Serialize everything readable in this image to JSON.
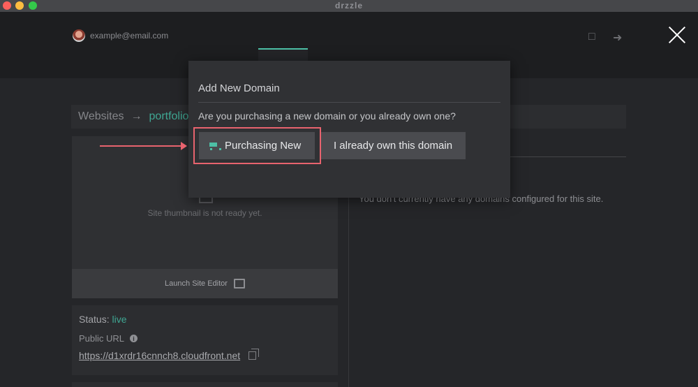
{
  "window": {
    "app_title": "drzzle"
  },
  "header": {
    "user_email": "example@email.com",
    "icons": [
      "chat-icon",
      "logout-icon",
      "close-icon"
    ]
  },
  "tabs": [
    {
      "icon": "browser-icon",
      "active": true
    },
    {
      "icon": "user-icon",
      "active": false
    },
    {
      "icon": "gear-icon",
      "active": false
    }
  ],
  "breadcrumb": {
    "root": "Websites",
    "separator": "→",
    "current": "portfolio"
  },
  "site_panel": {
    "thumbnail_message": "Site thumbnail is not ready yet.",
    "launch_label": "Launch Site Editor",
    "status_label": "Status:",
    "status_value": "live",
    "public_url_label": "Public URL",
    "public_url": "https://d1xrdr16cnnch8.cloudfront.net"
  },
  "domains_panel": {
    "empty_message": "You don't currently have any domains configured for this site."
  },
  "modal": {
    "title": "Add New Domain",
    "question": "Are you purchasing a new domain or you already own one?",
    "purchase_button": "Purchasing New",
    "own_button": "I already own this domain"
  },
  "colors": {
    "accent": "#4dbfa6",
    "annotation": "#e8636e",
    "background": "#252629",
    "modal": "#303134"
  }
}
